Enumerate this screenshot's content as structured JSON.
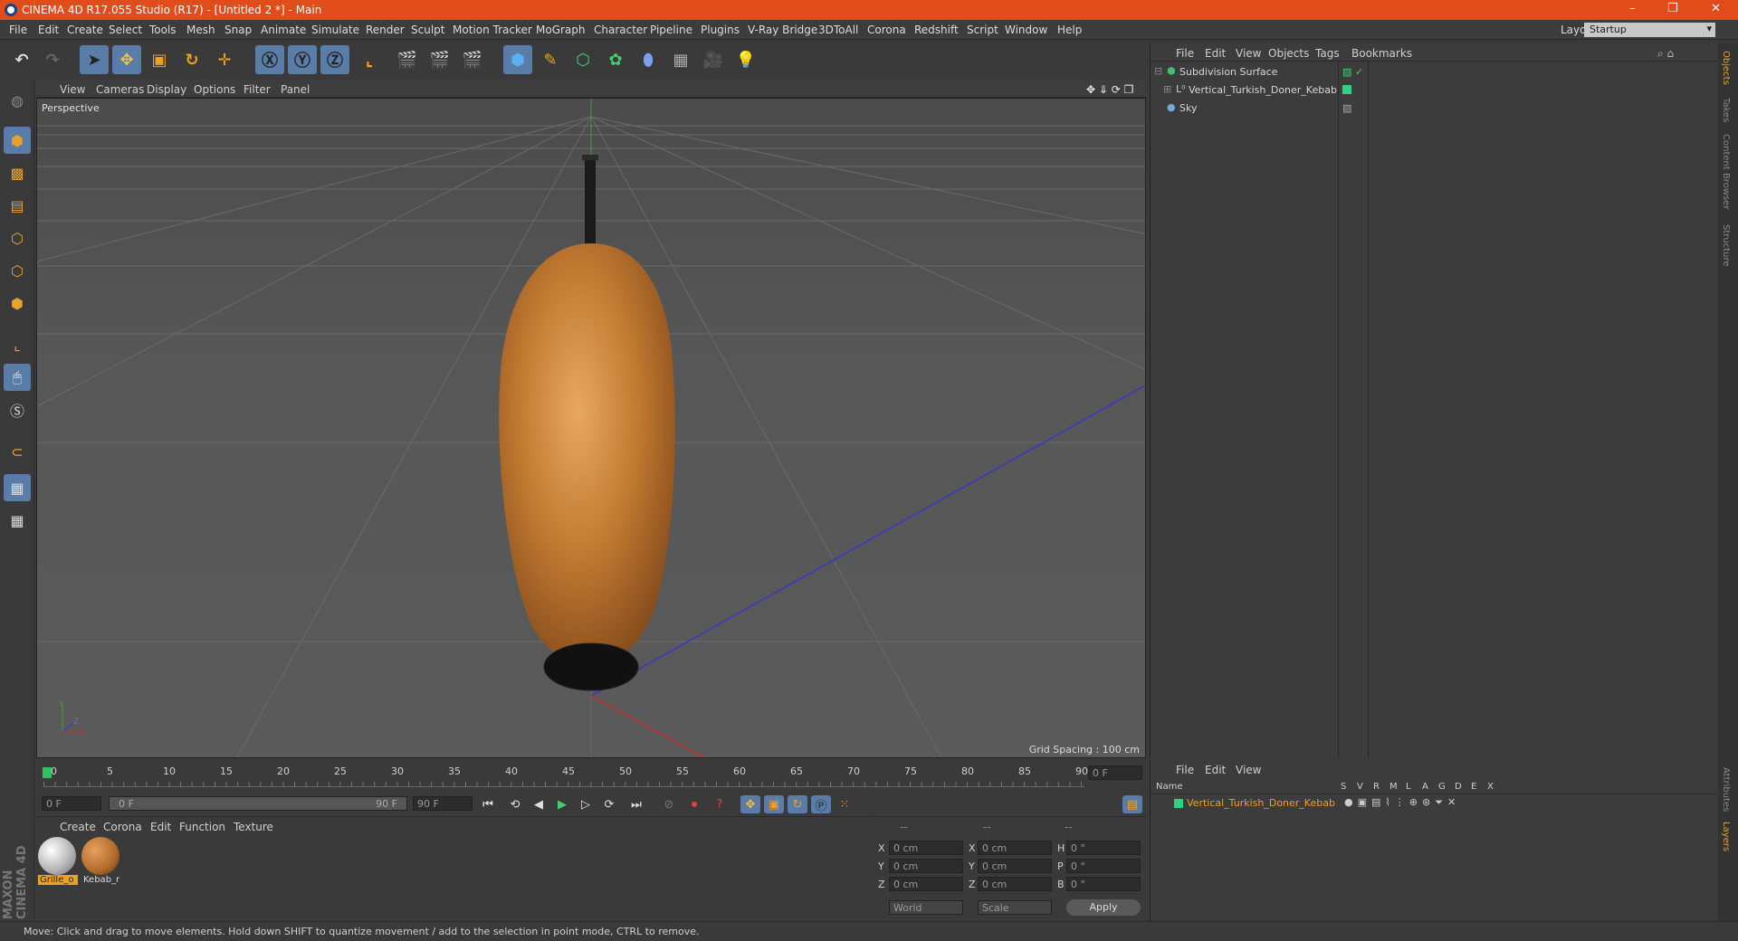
{
  "title_bar": {
    "title": "CINEMA 4D R17.055 Studio (R17) - [Untitled 2 *] - Main",
    "minimize": "–",
    "restore": "❐",
    "close": "✕"
  },
  "menu": [
    "File",
    "Edit",
    "Create",
    "Select",
    "Tools",
    "Mesh",
    "Snap",
    "Animate",
    "Simulate",
    "Render",
    "Sculpt",
    "Motion Tracker",
    "MoGraph",
    "Character",
    "Pipeline",
    "Plugins",
    "V-Ray Bridge",
    "3DToAll",
    "Corona",
    "Redshift",
    "Script",
    "Window",
    "Help"
  ],
  "layout": {
    "label": "Layout:",
    "value": "Startup"
  },
  "viewport": {
    "menu": [
      "View",
      "Cameras",
      "Display",
      "Options",
      "Filter",
      "Panel"
    ],
    "label": "Perspective",
    "grid_spacing": "Grid Spacing : 100 cm",
    "axis_y": "Y",
    "axis_z": "Z",
    "axis_x": "X"
  },
  "timeline": {
    "ticks": [
      "0",
      "5",
      "10",
      "15",
      "20",
      "25",
      "30",
      "35",
      "40",
      "45",
      "50",
      "55",
      "60",
      "65",
      "70",
      "75",
      "80",
      "85",
      "90"
    ],
    "current_frame": "0 F",
    "start_field": "0 F",
    "range_start": "0 F",
    "range_end": "90 F",
    "end_field": "90 F"
  },
  "material_manager": {
    "menu": [
      "Create",
      "Corona",
      "Edit",
      "Function",
      "Texture"
    ],
    "materials": [
      {
        "name": "Grille_o",
        "color": "#b0b0b0"
      },
      {
        "name": "Kebab_r",
        "color": "#b06a2a"
      }
    ]
  },
  "coordinates": {
    "headers": [
      "--",
      "--",
      "--"
    ],
    "rows": [
      {
        "a": "X",
        "av": "0 cm",
        "b": "X",
        "bv": "0 cm",
        "c": "H",
        "cv": "0 °"
      },
      {
        "a": "Y",
        "av": "0 cm",
        "b": "Y",
        "bv": "0 cm",
        "c": "P",
        "cv": "0 °"
      },
      {
        "a": "Z",
        "av": "0 cm",
        "b": "Z",
        "bv": "0 cm",
        "c": "B",
        "cv": "0 °"
      }
    ],
    "world": "World",
    "scale": "Scale",
    "apply": "Apply"
  },
  "object_manager": {
    "menu": [
      "File",
      "Edit",
      "View",
      "Objects",
      "Tags",
      "Bookmarks"
    ],
    "objects": [
      {
        "name": "Subdivision Surface",
        "icon_color": "#3fbf70"
      },
      {
        "name": "Vertical_Turkish_Doner_Kebab",
        "icon_color": "#c8c8c8"
      },
      {
        "name": "Sky",
        "icon_color": "#7aa6e0"
      }
    ]
  },
  "layer_manager": {
    "menu": [
      "File",
      "Edit",
      "View"
    ],
    "columns": [
      "Name",
      "S",
      "V",
      "R",
      "M",
      "L",
      "A",
      "G",
      "D",
      "E",
      "X"
    ],
    "row_name": "Vertical_Turkish_Doner_Kebab"
  },
  "right_tabs": [
    "Objects",
    "Takes",
    "Content Browser",
    "Structure",
    "Attributes",
    "Layers"
  ],
  "brand": "MAXON CINEMA 4D",
  "status": "Move: Click and drag to move elements. Hold down SHIFT to quantize movement / add to the selection in point mode, CTRL to remove."
}
